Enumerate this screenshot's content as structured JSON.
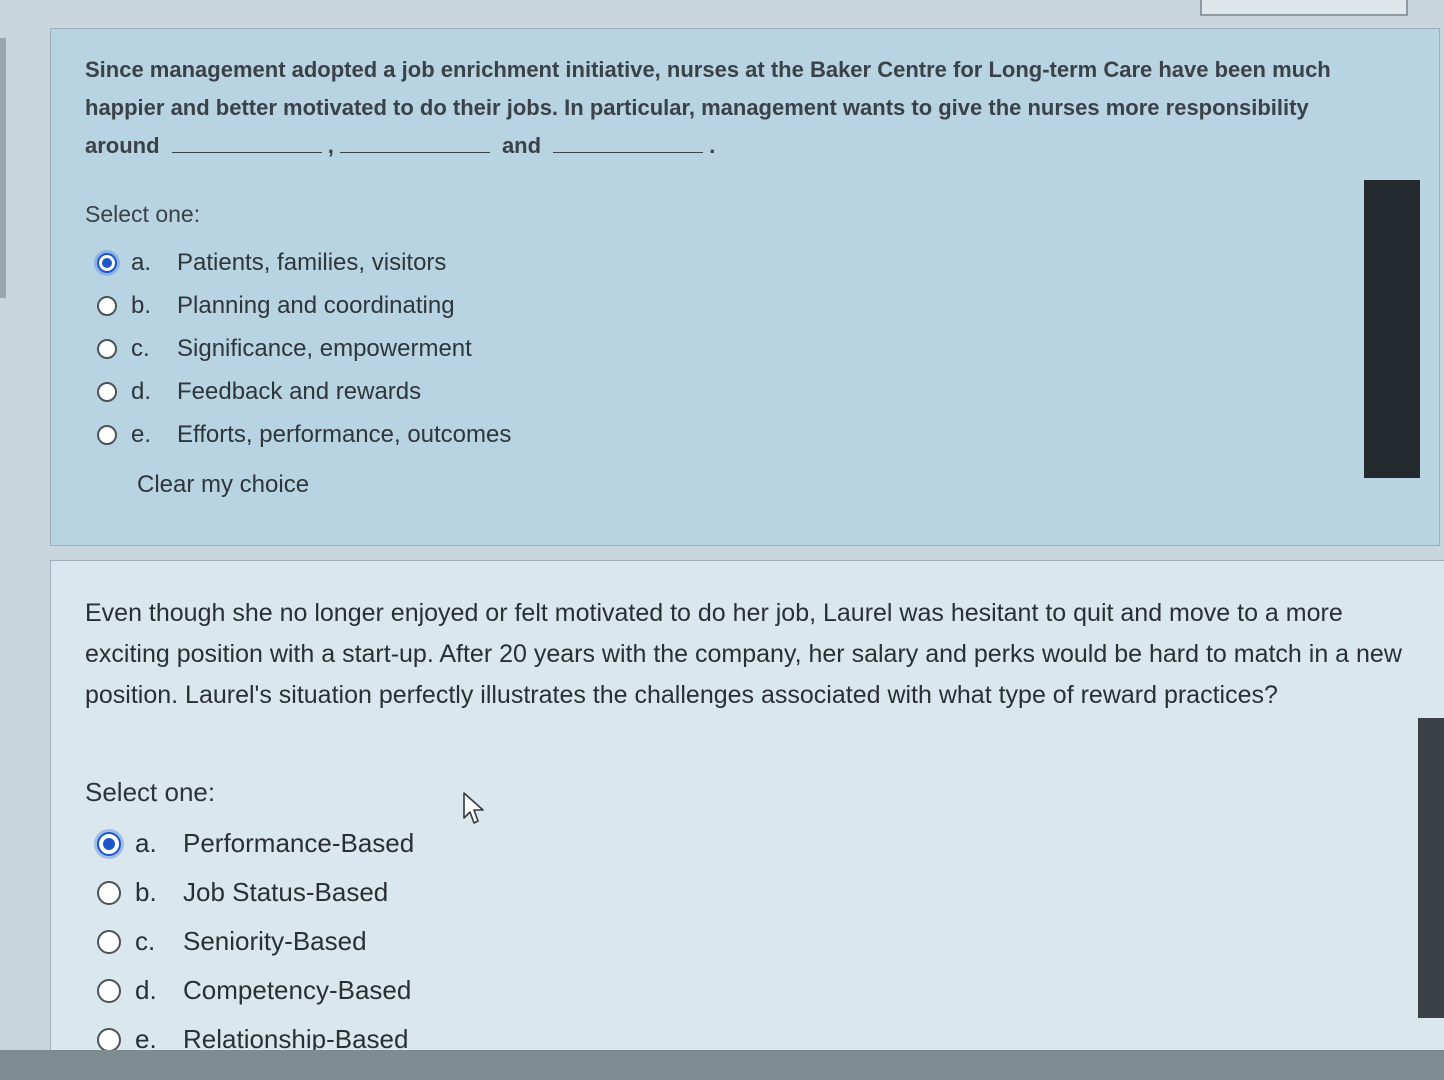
{
  "question1": {
    "text_part1": "Since management adopted a job enrichment initiative, nurses at the Baker Centre for Long-term Care have been much happier and better motivated to do their jobs. In particular, management wants to give the nurses more responsibility around",
    "comma": ",",
    "and_word": "and",
    "period": ".",
    "prompt": "Select one:",
    "selected": "a",
    "options": [
      {
        "letter": "a.",
        "label": "Patients, families, visitors"
      },
      {
        "letter": "b.",
        "label": "Planning and coordinating"
      },
      {
        "letter": "c.",
        "label": "Significance, empowerment"
      },
      {
        "letter": "d.",
        "label": "Feedback and rewards"
      },
      {
        "letter": "e.",
        "label": "Efforts, performance, outcomes"
      }
    ],
    "clear_label": "Clear my choice"
  },
  "question2": {
    "text": "Even though she no longer enjoyed or felt motivated to do her job, Laurel was hesitant to quit and move to a more exciting position with a start-up. After 20 years with the company, her salary and perks would be hard to match in a new position. Laurel's situation perfectly illustrates the challenges associated with what type of reward practices?",
    "prompt": "Select one:",
    "selected": "a",
    "options": [
      {
        "letter": "a.",
        "label": "Performance-Based"
      },
      {
        "letter": "b.",
        "label": "Job Status-Based"
      },
      {
        "letter": "c.",
        "label": "Seniority-Based"
      },
      {
        "letter": "d.",
        "label": "Competency-Based"
      },
      {
        "letter": "e.",
        "label": "Relationship-Based"
      }
    ]
  },
  "colors": {
    "radio_selected": "#1d56c8",
    "panel1_bg": "#b8d4e2",
    "panel2_bg": "#dbe7ee"
  },
  "icons": {
    "cursor": "mouse-pointer-icon"
  }
}
